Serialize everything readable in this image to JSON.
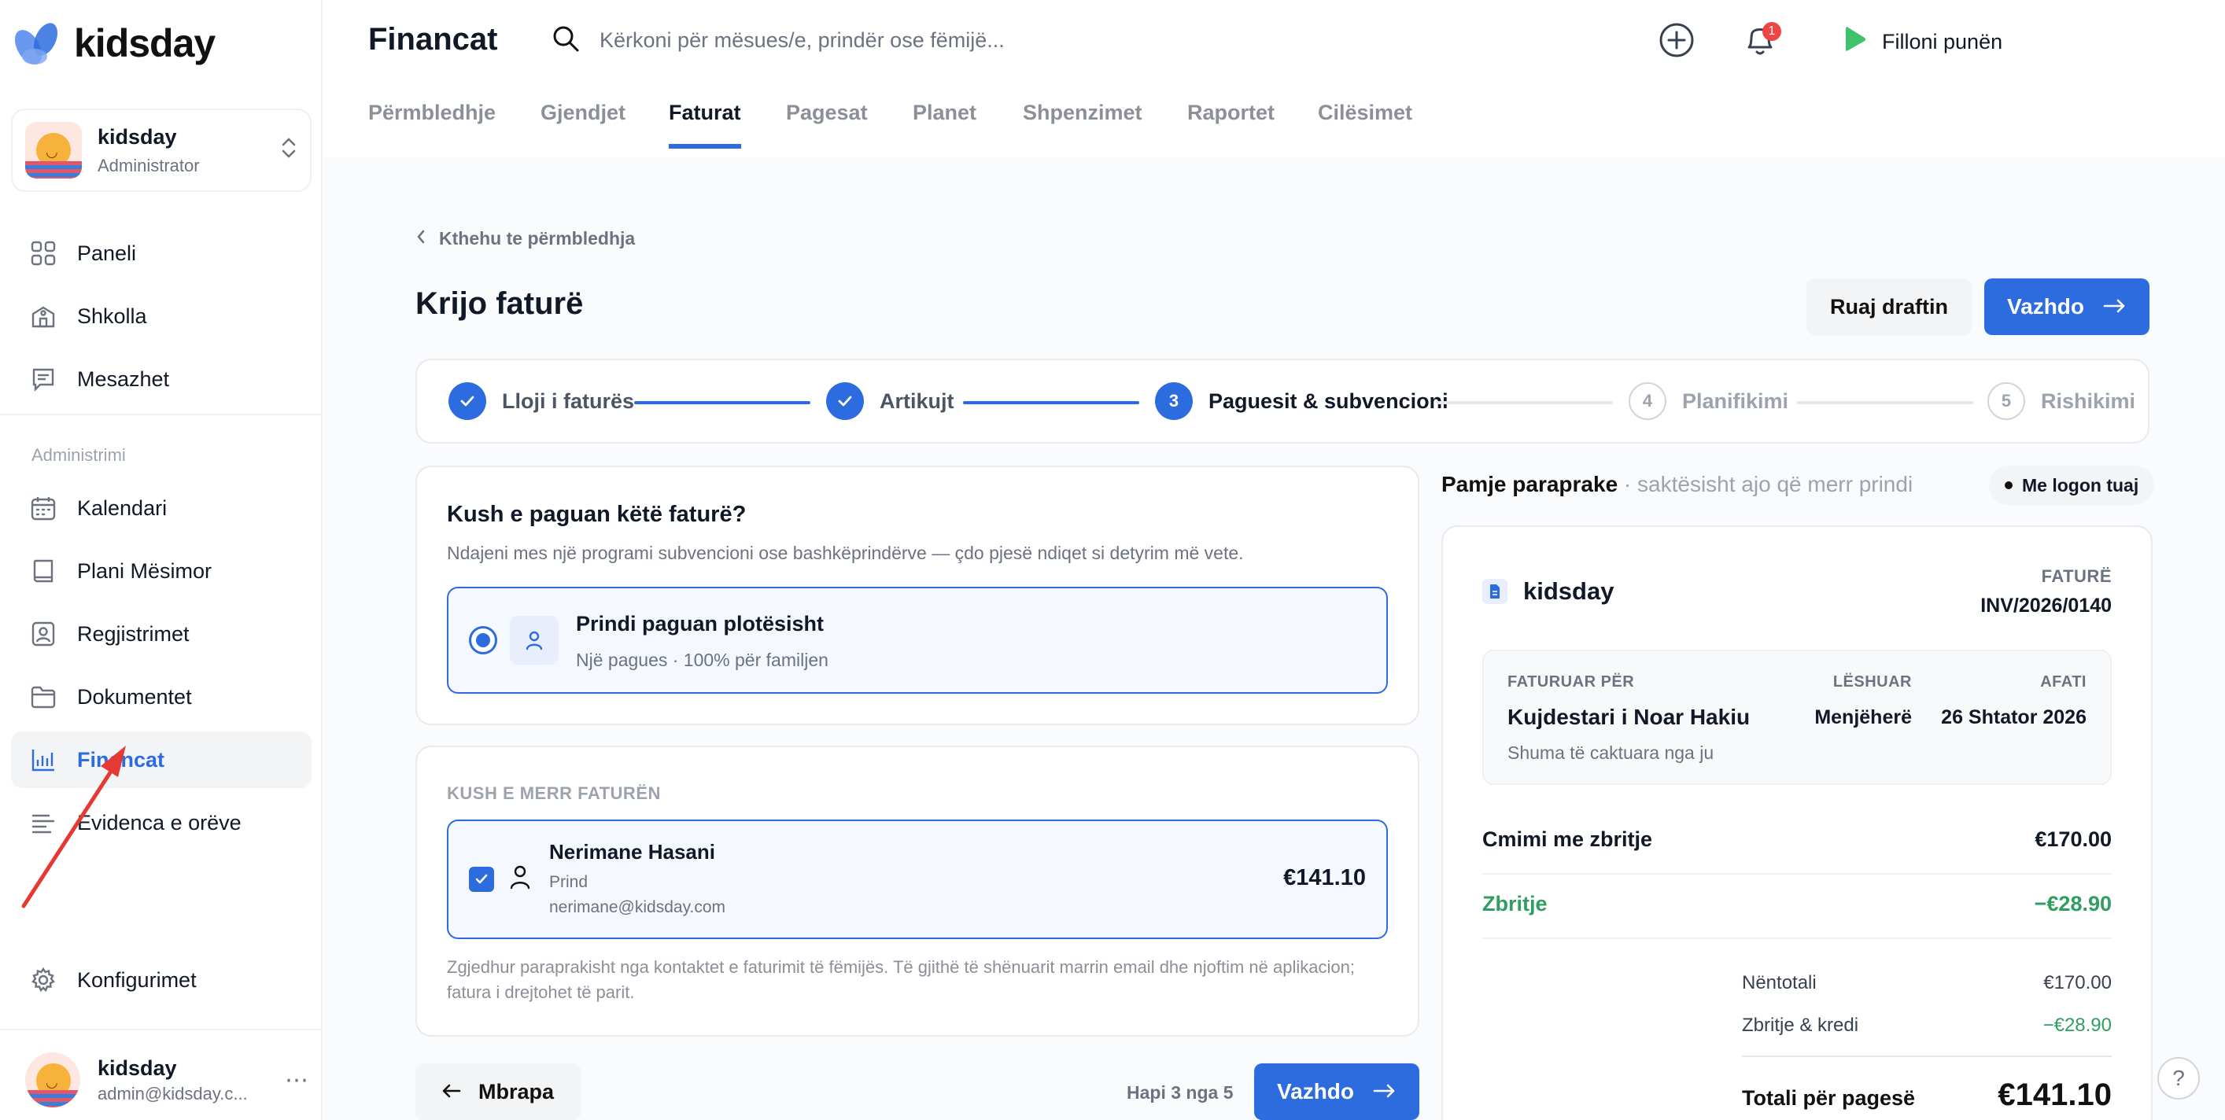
{
  "brand": {
    "name": "kidsday"
  },
  "org": {
    "name": "kidsday",
    "role": "Administrator"
  },
  "nav": {
    "main": [
      {
        "label": "Paneli",
        "icon": "grid-icon"
      },
      {
        "label": "Shkolla",
        "icon": "school-icon"
      },
      {
        "label": "Mesazhet",
        "icon": "message-icon"
      }
    ],
    "section_label": "Administrimi",
    "admin": [
      {
        "label": "Kalendari",
        "icon": "calendar-icon"
      },
      {
        "label": "Plani Mësimor",
        "icon": "book-icon"
      },
      {
        "label": "Regjistrimet",
        "icon": "id-card-icon"
      },
      {
        "label": "Dokumentet",
        "icon": "folder-icon"
      },
      {
        "label": "Financat",
        "icon": "chart-icon",
        "active": true
      },
      {
        "label": "Evidenca e orëve",
        "icon": "list-icon"
      }
    ],
    "settings": {
      "label": "Konfigurimet",
      "icon": "gear-icon"
    }
  },
  "user": {
    "name": "kidsday",
    "email": "admin@kidsday.c..."
  },
  "header": {
    "title": "Financat",
    "search_placeholder": "Kërkoni për mësues/e, prindër ose fëmijë...",
    "start_work": "Filloni punën",
    "notifications_count": "1"
  },
  "tabs": [
    "Përmbledhje",
    "Gjendjet",
    "Faturat",
    "Pagesat",
    "Planet",
    "Shpenzimet",
    "Raportet",
    "Cilësimet"
  ],
  "active_tab": "Faturat",
  "page": {
    "back_link": "Kthehu te përmbledhja",
    "title": "Krijo faturë",
    "save_draft": "Ruaj draftin",
    "continue": "Vazhdo"
  },
  "steps": [
    {
      "num": "1",
      "label": "Lloji i faturës",
      "state": "done"
    },
    {
      "num": "2",
      "label": "Artikujt",
      "state": "done"
    },
    {
      "num": "3",
      "label": "Paguesit & subvencioni",
      "state": "current"
    },
    {
      "num": "4",
      "label": "Planifikimi",
      "state": "todo"
    },
    {
      "num": "5",
      "label": "Rishikimi",
      "state": "todo"
    }
  ],
  "payer": {
    "question": "Kush e paguan këtë faturë?",
    "description": "Ndajeni mes një programi subvencioni ose bashkëprindërve — çdo pjesë ndiqet si detyrim më vete.",
    "option_title": "Prindi paguan plotësisht",
    "option_sub": "Një pagues · 100% për familjen"
  },
  "recipient": {
    "section": "KUSH E MERR FATURËN",
    "name": "Nerimane Hasani",
    "role": "Prind",
    "email": "nerimane@kidsday.com",
    "amount": "€141.10",
    "note": "Zgjedhur paraprakisht nga kontaktet e faturimit të fëmijës. Të gjithë të shënuarit marrin email dhe njoftim në aplikacion; fatura i drejtohet të parit."
  },
  "footer": {
    "back": "Mbrapa",
    "step_counter": "Hapi 3 nga 5",
    "continue": "Vazhdo"
  },
  "preview": {
    "title": "Pamje paraprake",
    "subtitle": "· saktësisht ajo që merr prindi",
    "logo_pill": "Me logon tuaj",
    "brand": "kidsday",
    "invoice_label": "FATURË",
    "invoice_number": "INV/2026/0140",
    "billed_to_label": "FATURUAR PËR",
    "billed_to": "Kujdestari i Noar Hakiu",
    "billed_to_sub": "Shuma të caktuara nga ju",
    "issued_label": "LËSHUAR",
    "issued": "Menjëherë",
    "due_label": "AFATI",
    "due": "26 Shtator 2026",
    "lines": [
      {
        "label": "Cmimi me zbritje",
        "amount": "€170.00"
      },
      {
        "label": "Zbritje",
        "amount": "−€28.90"
      }
    ],
    "subtotal_label": "Nëntotali",
    "subtotal": "€170.00",
    "discounts_label": "Zbritje & kredi",
    "discounts": "−€28.90",
    "total_label": "Totali për pagesë",
    "total": "€141.10"
  },
  "colors": {
    "accent": "#2d6cdf",
    "green": "#2f9e5f",
    "badge": "#ef4444"
  }
}
